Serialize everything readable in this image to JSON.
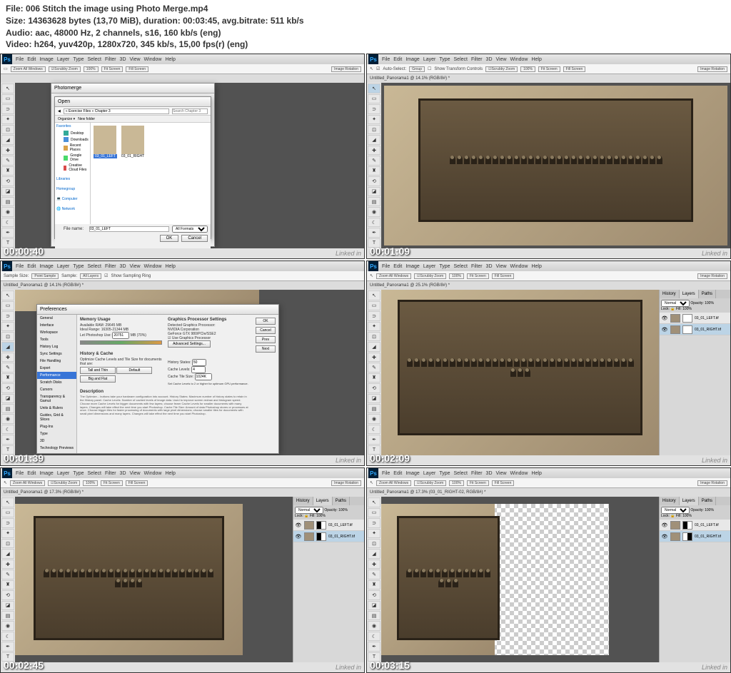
{
  "header": {
    "file_label": "File:",
    "file_name": "006 Stitch the image using Photo Merge.mp4",
    "size_label": "Size:",
    "size_value": "14363628 bytes (13,70 MiB), duration: 00:03:45, avg.bitrate: 511 kb/s",
    "audio_label": "Audio:",
    "audio_value": "aac, 48000 Hz, 2 channels, s16, 160 kb/s (eng)",
    "video_label": "Video:",
    "video_value": "h264, yuv420p, 1280x720, 345 kb/s, 15,00 fps(r) (eng)"
  },
  "menus": [
    "File",
    "Edit",
    "Image",
    "Layer",
    "Type",
    "Select",
    "Filter",
    "3D",
    "View",
    "Window",
    "Help"
  ],
  "timestamps": [
    "00:00:40",
    "00:01:09",
    "00:01:39",
    "00:02:09",
    "00:02:45",
    "00:03:15"
  ],
  "watermark": "Linked in",
  "frame1": {
    "dialog_title": "Photomerge",
    "open_title": "Open",
    "nav_buttons": "Organize ▾",
    "path": "« Exercise Files » Chapter 3",
    "search_placeholder": "Search Chapter 3",
    "sidebar": {
      "favorites": "Favorites",
      "items1": [
        "Desktop",
        "Downloads",
        "Recent Places",
        "Google Drive",
        "Creative Cloud Files"
      ],
      "libraries": "Libraries",
      "homegroup": "Homegroup",
      "computer": "Computer",
      "network": "Network"
    },
    "thumbs": [
      "03_01_LEFT",
      "03_01_RIGHT"
    ],
    "filename_label": "File name:",
    "filename_value": "03_01_LEFT",
    "filter": "All Formats",
    "ok": "OK",
    "cancel": "Cancel"
  },
  "frame2": {
    "tab": "Untitled_Panorama1 @ 14.1% (RGB/8#) *",
    "status": "14.1%"
  },
  "frame3": {
    "tab": "Untitled_Panorama1 @ 14.1% (RGB/8#) *",
    "dialog_title": "Preferences",
    "nav": [
      "General",
      "Interface",
      "Workspace",
      "Tools",
      "History Log",
      "Sync Settings",
      "File Handling",
      "Export",
      "",
      "Scratch Disks",
      "Cursors",
      "Transparency & Gamut",
      "Units & Rulers",
      "Guides, Grid & Slices",
      "Plug-Ins",
      "Type",
      "3D",
      "Technology Previews"
    ],
    "nav_selected": "Performance",
    "memory_title": "Memory Usage",
    "available_ram_label": "Available RAM:",
    "available_ram": "29645 MB",
    "ideal_range_label": "Ideal Range:",
    "ideal_range": "16305-21344 MB",
    "let_ps_label": "Let Photoshop Use:",
    "let_ps_value": "20751",
    "let_ps_pct": "MB (70%)",
    "gpu_title": "Graphics Processor Settings",
    "gpu_detected": "Detected Graphics Processor:",
    "gpu_name": "NVIDIA Corporation",
    "gpu_model": "GeForce GTX 980/PCIe/SSE2",
    "gpu_check": "Use Graphics Processor",
    "gpu_adv": "Advanced Settings...",
    "history_title": "History & Cache",
    "optimize": "Optimize Cache Levels and Tile Size for documents that are:",
    "opt1": "Tall and Thin",
    "opt2": "Default",
    "opt3": "Big and Flat",
    "hist_states_label": "History States:",
    "hist_states": "50",
    "cache_levels_label": "Cache Levels:",
    "cache_levels": "4",
    "cache_tile_label": "Cache Tile Size:",
    "cache_tile": "1024K",
    "cache_hint": "Set Cache Levels to 2 or higher for optimum GPU performance.",
    "desc_title": "Description",
    "btns": [
      "OK",
      "Cancel",
      "Prev",
      "Next"
    ]
  },
  "frame4": {
    "tab": "Untitled_Panorama1 @ 25.1% (RGB/8#) *",
    "panel_tabs": [
      "History",
      "Layers",
      "Paths"
    ],
    "blend": "Normal",
    "opacity_label": "Opacity:",
    "opacity": "100%",
    "lock_label": "Lock:",
    "fill_label": "Fill:",
    "fill": "100%",
    "layers": [
      "03_01_LEFT.tif",
      "03_01_RIGHT.tif"
    ]
  },
  "frame5": {
    "tab": "Untitled_Panorama1 @ 17.3% (RGB/8#) *",
    "panel_tabs": [
      "History",
      "Layers",
      "Paths"
    ],
    "blend": "Normal",
    "opacity": "100%",
    "fill": "100%",
    "layers": [
      "03_01_LEFT.tif",
      "03_01_RIGHT.tif"
    ]
  },
  "frame6": {
    "tab": "Untitled_Panorama1 @ 17.3% (03_01_RIGHT-02, RGB/8#) *",
    "panel_tabs": [
      "History",
      "Layers",
      "Paths"
    ],
    "blend": "Normal",
    "opacity": "100%",
    "fill": "100%",
    "layers": [
      "03_01_LEFT.tif",
      "03_01_RIGHT.tif"
    ]
  },
  "options": {
    "sample_size": "Sample Size:",
    "point_sample": "Point Sample",
    "sample": "Sample:",
    "all_layers": "All Layers",
    "show_ring": "Show Sampling Ring",
    "auto_select": "Auto-Select:",
    "group": "Group",
    "transform": "Show Transform Controls",
    "scroll_zoom": "Scrubby Zoom",
    "pct100": "100%",
    "fit": "Fit Screen",
    "fill_screen": "Fill Screen",
    "zoom_all": "Zoom All Windows",
    "image_rotation": "Image Rotation"
  }
}
